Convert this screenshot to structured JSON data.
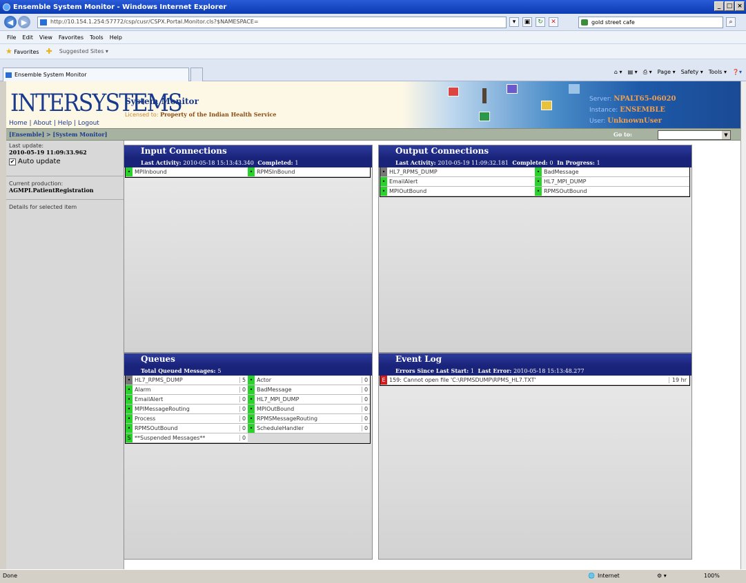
{
  "window": {
    "title": "Ensemble System Monitor - Windows Internet Explorer",
    "buttons": [
      "_",
      "□",
      "×"
    ]
  },
  "browser": {
    "address": "http://10.154.1.254:57772/csp/cusr/CSPX.Portal.Monitor.cls?$NAMESPACE=",
    "search_value": "gold street cafe",
    "menu": [
      "File",
      "Edit",
      "View",
      "Favorites",
      "Tools",
      "Help"
    ],
    "favorites_label": "Favorites",
    "suggested_sites": "Suggested Sites ▾",
    "tab_title": "Ensemble System Monitor",
    "commands": [
      "Page ▾",
      "Safety ▾",
      "Tools ▾"
    ]
  },
  "header": {
    "logo": "INTERSYSTEMS",
    "links": [
      "Home",
      "About",
      "Help",
      "Logout"
    ],
    "app_title": "System Monitor",
    "license_label": "Licensed to:",
    "license_value": "Property of the Indian Health Service",
    "server_label": "Server:",
    "server": "NPALT65-06020",
    "instance_label": "Instance:",
    "instance": "ENSEMBLE",
    "user_label": "User:",
    "user": "UnknownUser"
  },
  "breadcrumb": "[Ensemble] > [System Monitor]",
  "goto_label": "Go to:",
  "sidebar": {
    "last_update_label": "Last update:",
    "last_update": "2010-05-19 11:09:33.962",
    "auto_update": "Auto update",
    "production_label": "Current production:",
    "production": "AGMPI.PatientRegistration",
    "details": "Details for selected item"
  },
  "input": {
    "title": "Input Connections",
    "activity_label": "Last Activity:",
    "activity": "2010-05-18 15:13:43.340",
    "completed_label": "Completed:",
    "completed": "1",
    "items": [
      "MPIInbound",
      "RPMSInBound"
    ]
  },
  "output": {
    "title": "Output Connections",
    "activity_label": "Last Activity:",
    "activity": "2010-05-19 11:09:32.181",
    "completed_label": "Completed:",
    "completed": "0",
    "progress_label": "In Progress:",
    "progress": "1",
    "items": [
      {
        "name": "HL7_RPMS_DUMP",
        "status": "gray"
      },
      {
        "name": "BadMessage",
        "status": "green"
      },
      {
        "name": "EmailAlert",
        "status": "green"
      },
      {
        "name": "HL7_MPI_DUMP",
        "status": "green"
      },
      {
        "name": "MPIOutBound",
        "status": "green"
      },
      {
        "name": "RPMSOutBound",
        "status": "green"
      }
    ]
  },
  "queues": {
    "title": "Queues",
    "total_label": "Total Queued Messages:",
    "total": "5",
    "items": [
      {
        "name": "HL7_RPMS_DUMP",
        "count": "5",
        "status": "gray"
      },
      {
        "name": "Actor",
        "count": "0",
        "status": "green"
      },
      {
        "name": "Alarm",
        "count": "0",
        "status": "green"
      },
      {
        "name": "BadMessage",
        "count": "0",
        "status": "green"
      },
      {
        "name": "EmailAlert",
        "count": "0",
        "status": "green"
      },
      {
        "name": "HL7_MPI_DUMP",
        "count": "0",
        "status": "green"
      },
      {
        "name": "MPIMessageRouting",
        "count": "0",
        "status": "green"
      },
      {
        "name": "MPIOutBound",
        "count": "0",
        "status": "green"
      },
      {
        "name": "Process",
        "count": "0",
        "status": "green"
      },
      {
        "name": "RPMSMessageRouting",
        "count": "0",
        "status": "green"
      },
      {
        "name": "RPMSOutBound",
        "count": "0",
        "status": "green"
      },
      {
        "name": "ScheduleHandler",
        "count": "0",
        "status": "green"
      },
      {
        "name": "**Suspended Messages**",
        "count": "0",
        "status": "green",
        "mark": "S"
      }
    ]
  },
  "eventlog": {
    "title": "Event Log",
    "errors_label": "Errors Since Last Start:",
    "errors": "1",
    "last_error_label": "Last Error:",
    "last_error": "2010-05-18 15:13:48.277",
    "items": [
      {
        "mark": "E",
        "text": "159: Cannot open file 'C:\\RPMSDUMP\\RPMS_HL7.TXT'",
        "age": "19 hr"
      }
    ]
  },
  "statusbar": {
    "left": "Done",
    "zone": "Internet",
    "zoom": "100%"
  },
  "colors": {
    "panel_title": "#1a237a",
    "status_ok": "#2bd22b",
    "status_idle": "#777777",
    "status_error": "#d41c1c"
  }
}
